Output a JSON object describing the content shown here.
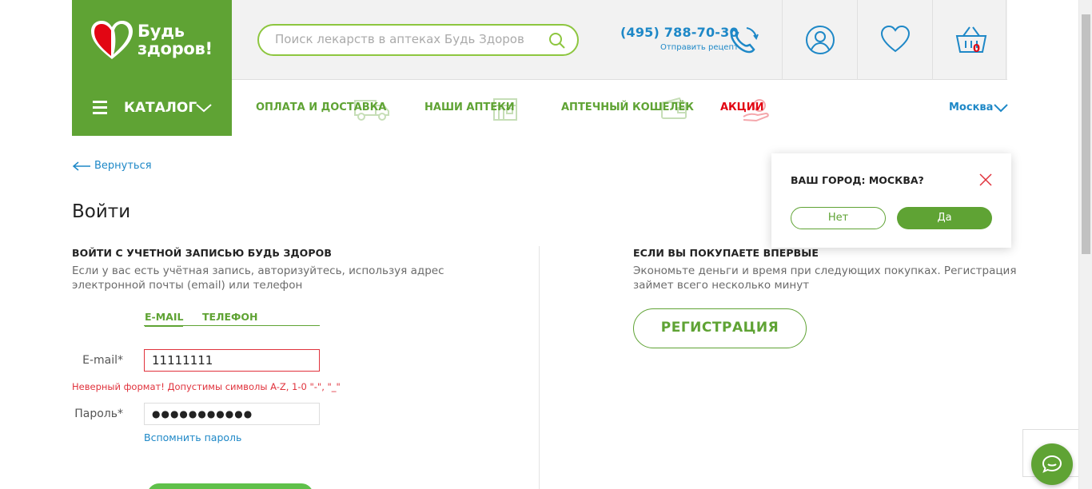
{
  "header": {
    "logo_line1": "Будь",
    "logo_line2": "здоров!",
    "search_placeholder": "Поиск лекарств в аптеках Будь Здоров",
    "phone": "(495) 788-70-30",
    "phone_sub": "Отправить рецепт",
    "cart_count": "0"
  },
  "nav": {
    "catalog": "КАТАЛОГ",
    "links": [
      "ОПЛАТА И ДОСТАВКА",
      "НАШИ АПТЕКИ",
      "АПТЕЧНЫЙ КОШЕЛЁК",
      "АКЦИИ"
    ],
    "city": "Москва"
  },
  "page": {
    "back": "Вернуться",
    "title": "Войти"
  },
  "login": {
    "title": "ВОЙТИ С УЧЕТНОЙ ЗАПИСЬЮ БУДЬ ЗДОРОВ",
    "desc_line1": "Если у вас есть учётная запись, авторизуйтесь, используя адрес",
    "desc_line2": "электронной почты (email) или телефон",
    "tab_email": "E-MAIL",
    "tab_phone": "ТЕЛЕФОН",
    "email_label": "E-mail*",
    "email_value": "11111111",
    "error": "Неверный формат! Допустимы символы A-Z, 1-0 \"-\", \"_\"",
    "password_label": "Пароль*",
    "password_value": "●●●●●●●●●●●",
    "remind": "Вспомнить пароль"
  },
  "register": {
    "title": "ЕСЛИ ВЫ ПОКУПАЕТЕ ВПЕРВЫЕ",
    "desc_line1": "Экономьте деньги и время при следующих покупках. Регистрация",
    "desc_line2": "займет всего несколько минут",
    "button": "РЕГИСТРАЦИЯ"
  },
  "city_popup": {
    "question": "ВАШ ГОРОД: МОСКВА?",
    "no": "Нет",
    "yes": "Да"
  },
  "colors": {
    "brand_green": "#5fa334",
    "link_blue": "#1e88c7",
    "error_red": "#e0323c"
  }
}
